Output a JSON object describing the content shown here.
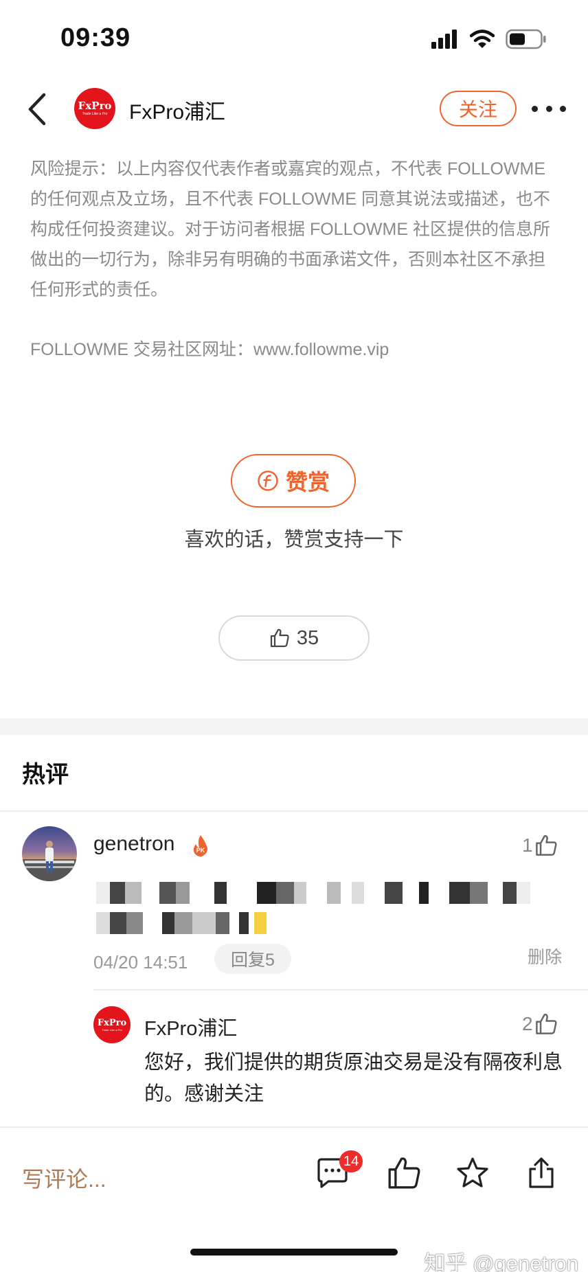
{
  "status": {
    "time": "09:39",
    "icons": [
      "signal-icon",
      "wifi-icon",
      "battery-icon"
    ]
  },
  "nav": {
    "author_logo": "FxPro",
    "author_logo_tagline": "Trade Like a Pro",
    "author_name": "FxPro浦汇",
    "follow_label": "关注",
    "icons": [
      "back-arrow-icon",
      "more-icon"
    ]
  },
  "disclaimer": {
    "text": "风险提示：以上内容仅代表作者或嘉宾的观点，不代表 FOLLOWME 的任何观点及立场，且不代表 FOLLOWME 同意其说法或描述，也不构成任何投资建议。对于访问者根据 FOLLOWME 社区提供的信息所做出的一切行为，除非另有明确的书面承诺文件，否则本社区不承担任何形式的责任。",
    "site": "FOLLOWME 交易社区网址：www.followme.vip"
  },
  "reward": {
    "button_label": "赞赏",
    "icon": "coin-icon",
    "caption": "喜欢的话，赞赏支持一下"
  },
  "likes": {
    "count": "35",
    "icon": "thumb-up-icon"
  },
  "hot_comments": {
    "title": "热评",
    "comment": {
      "author": "genetron",
      "badge_icon": "pk-flame-badge-icon",
      "like_count": "1",
      "time": "04/20 14:51",
      "reply_label": "回复5",
      "delete_label": "删除"
    },
    "reply": {
      "author": "FxPro浦汇",
      "author_logo": "FxPro",
      "like_count": "2",
      "text": "您好，我们提供的期货原油交易是没有隔夜利息的。感谢关注"
    }
  },
  "bottom_bar": {
    "write_comment": "写评论...",
    "comment_badge": "14",
    "icons": [
      "comment-icon",
      "thumb-up-icon",
      "star-icon",
      "share-icon"
    ]
  },
  "watermark": "知乎 @genetron",
  "colors": {
    "accent": "#f0632d",
    "brand_red": "#e3141b",
    "badge_red": "#ee2c2c",
    "muted_text": "#8a8a8a",
    "write_comment": "#b07a52"
  }
}
